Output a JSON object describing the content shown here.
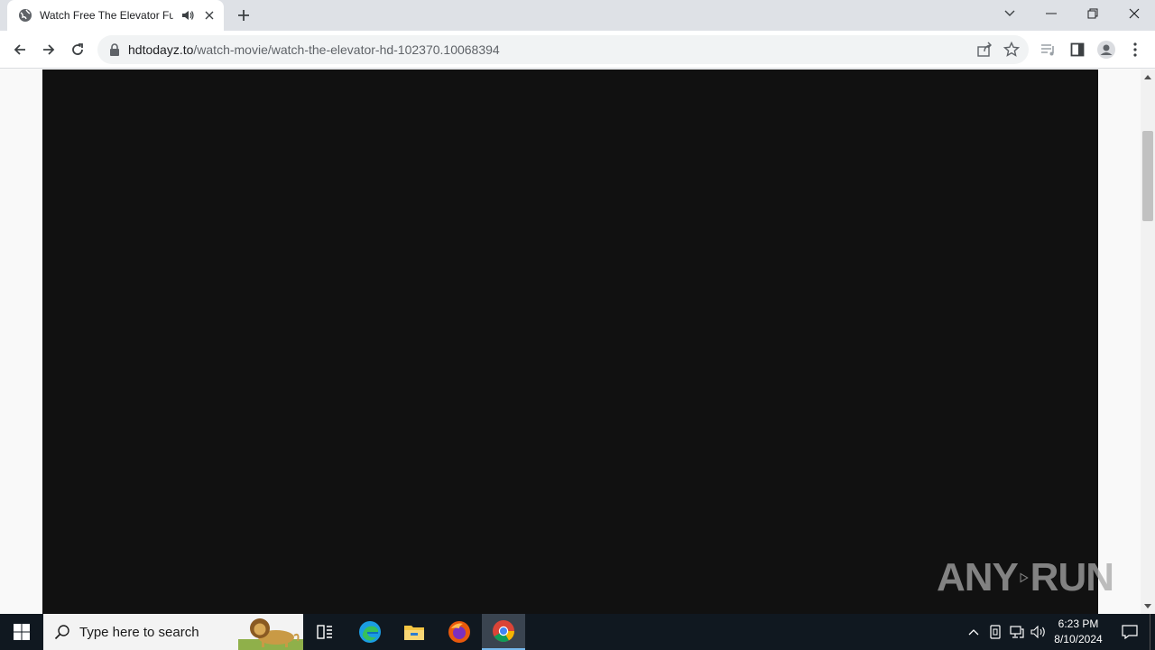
{
  "tab": {
    "title": "Watch Free The Elevator Full",
    "favicon": "globe-icon",
    "audio_icon": "speaker-icon",
    "close_icon": "close-icon"
  },
  "new_tab_icon": "plus-icon",
  "window_controls": {
    "dropdown_icon": "chevron-down-icon",
    "minimize_icon": "minimize-icon",
    "restore_icon": "restore-icon",
    "close_icon": "close-icon"
  },
  "toolbar": {
    "back_icon": "arrow-left-icon",
    "forward_icon": "arrow-right-icon",
    "reload_icon": "reload-icon",
    "url_host": "hdtodayz.to",
    "url_path": "/watch-movie/watch-the-elevator-hd-102370.10068394",
    "lock_icon": "lock-icon",
    "share_icon": "share-icon",
    "bookmark_icon": "star-icon",
    "media_icon": "media-queue-icon",
    "sidepanel_icon": "side-panel-icon",
    "profile_icon": "profile-icon",
    "menu_icon": "kebab-menu-icon"
  },
  "page": {
    "player_background": "#111111",
    "watermark_text": "ANY",
    "watermark_text2": "RUN"
  },
  "taskbar": {
    "search_placeholder": "Type here to search",
    "apps": [
      "task-view-icon",
      "edge-icon",
      "file-explorer-icon",
      "firefox-icon",
      "chrome-icon"
    ],
    "active_app": "chrome-icon",
    "time": "6:23 PM",
    "date": "8/10/2024"
  },
  "colors": {
    "tabbar": "#dee1e6",
    "taskbar": "#101820",
    "accent": "#76b9ed"
  }
}
